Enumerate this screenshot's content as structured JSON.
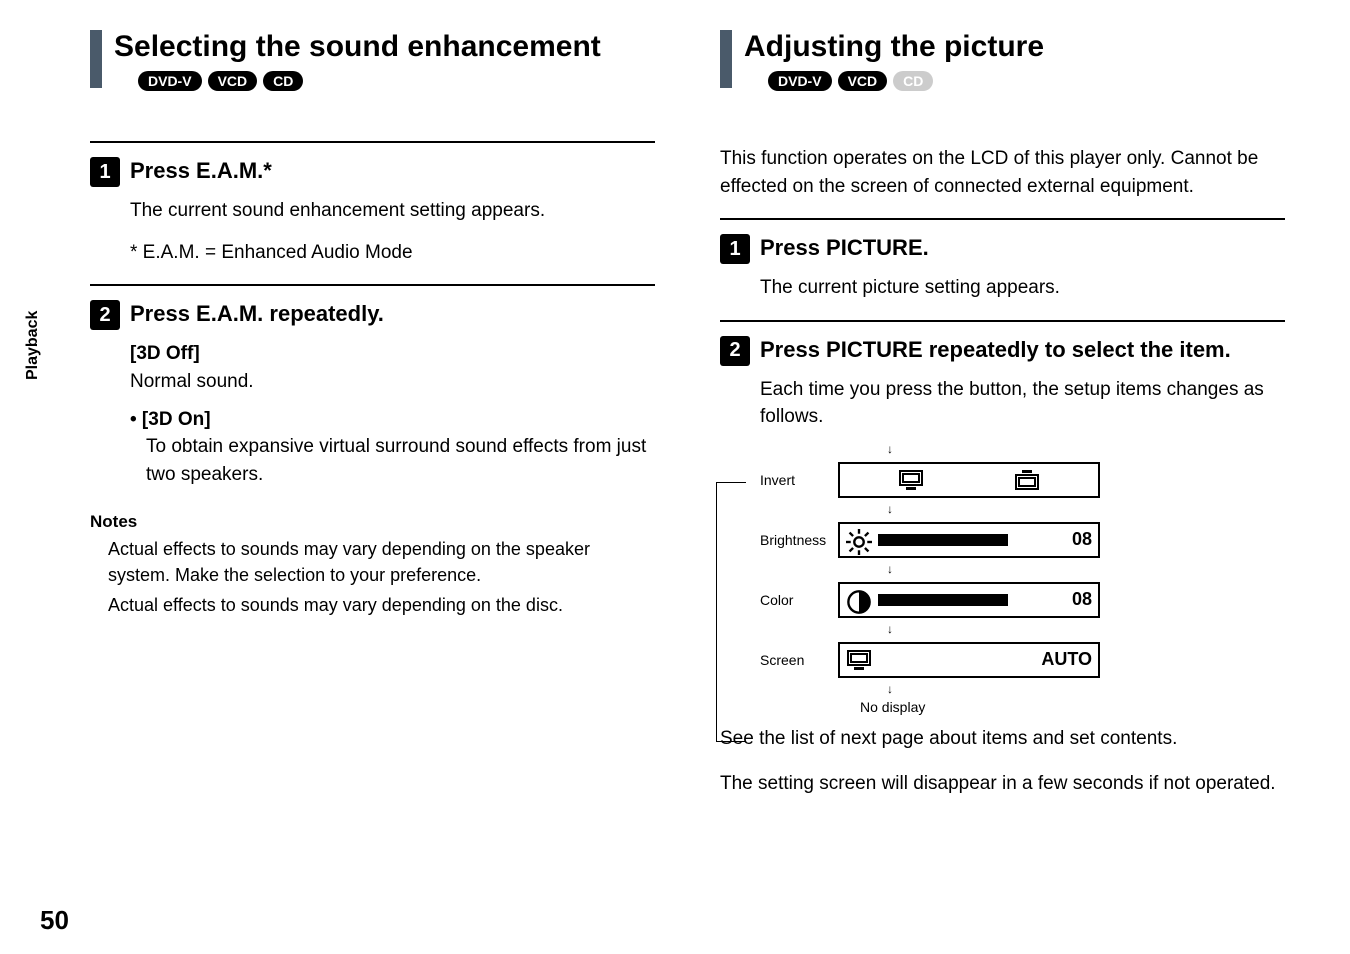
{
  "side_tab": "Playback",
  "page_number": "50",
  "left": {
    "title": "Selecting the sound enhancement",
    "badges": [
      "DVD-V",
      "VCD",
      "CD"
    ],
    "step1": {
      "title": "Press E.A.M.*",
      "body": "The current sound enhancement setting appears.",
      "footnote": "* E.A.M. = Enhanced Audio Mode"
    },
    "step2": {
      "title": "Press E.A.M. repeatedly.",
      "opt1_title": "[3D Off]",
      "opt1_body": "Normal sound.",
      "opt2_title": "• [3D On]",
      "opt2_body": "To obtain expansive virtual surround sound effects from just two speakers."
    },
    "notes_h": "Notes",
    "notes_body1": "Actual effects to sounds may vary depending on the speaker system. Make the selection to your preference.",
    "notes_body2": "Actual effects to sounds may vary depending on the disc."
  },
  "right": {
    "title": "Adjusting the picture",
    "badges": [
      "DVD-V",
      "VCD",
      "CD"
    ],
    "intro": "This function operates on the LCD of this player only. Cannot be effected on the screen of connected external equipment.",
    "step1": {
      "title": "Press PICTURE.",
      "body": "The current picture setting appears."
    },
    "step2": {
      "title": "Press PICTURE repeatedly to select the item.",
      "body": "Each time you press the button, the setup items changes as follows."
    },
    "diagram": {
      "rows": [
        {
          "label": "Invert",
          "value": ""
        },
        {
          "label": "Brightness",
          "value": "08"
        },
        {
          "label": "Color",
          "value": "08"
        },
        {
          "label": "Screen",
          "value": "AUTO"
        }
      ],
      "no_display": "No display"
    },
    "after1": "See the list of next page about items and set contents.",
    "after2": "The setting screen will disappear in a few seconds if not operated."
  },
  "chart_data": {
    "type": "table",
    "title": "Picture setup items cycle",
    "items": [
      {
        "name": "Invert",
        "value": null
      },
      {
        "name": "Brightness",
        "value": 8
      },
      {
        "name": "Color",
        "value": 8
      },
      {
        "name": "Screen",
        "value": "AUTO"
      },
      {
        "name": "No display",
        "value": null
      }
    ]
  }
}
